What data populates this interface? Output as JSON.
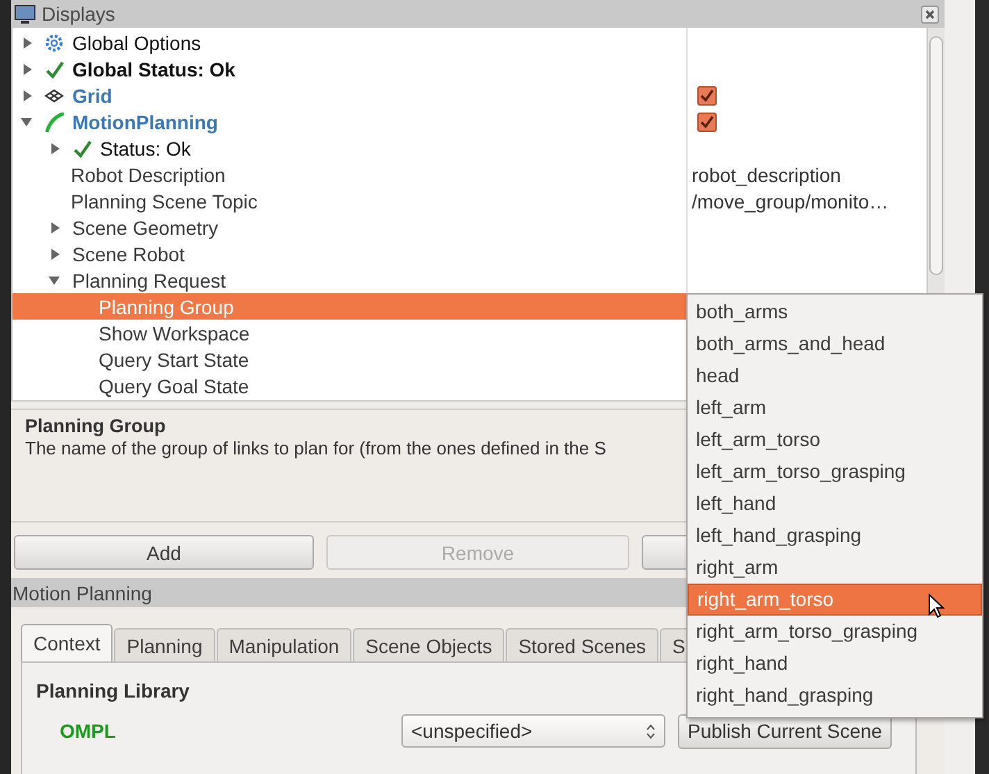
{
  "displays": {
    "title": "Displays",
    "tree": [
      {
        "label": "Global Options",
        "kind": "options",
        "expanded": false,
        "selected": false
      },
      {
        "label": "Global Status: Ok",
        "kind": "status",
        "expanded": false,
        "selected": false
      },
      {
        "label": "Grid",
        "kind": "grid",
        "expanded": false,
        "checked": true,
        "selected": false
      },
      {
        "label": "MotionPlanning",
        "kind": "planner",
        "expanded": true,
        "checked": true,
        "selected": false,
        "children": [
          {
            "label": "Status: Ok",
            "kind": "status",
            "expanded": false,
            "selected": false
          },
          {
            "label": "Robot Description",
            "kind": "property",
            "value": "robot_description",
            "selected": false
          },
          {
            "label": "Planning Scene Topic",
            "kind": "property",
            "value": "/move_group/monito…",
            "selected": false
          },
          {
            "label": "Scene Geometry",
            "kind": "property",
            "expanded": false,
            "selected": false
          },
          {
            "label": "Scene Robot",
            "kind": "property",
            "expanded": false,
            "selected": false
          },
          {
            "label": "Planning Request",
            "kind": "property",
            "expanded": true,
            "selected": false,
            "children": [
              {
                "label": "Planning Group",
                "kind": "property",
                "selected": true
              },
              {
                "label": "Show Workspace",
                "kind": "property",
                "selected": false
              },
              {
                "label": "Query Start State",
                "kind": "property",
                "selected": false
              },
              {
                "label": "Query Goal State",
                "kind": "property",
                "selected": false
              }
            ]
          }
        ]
      }
    ],
    "description": {
      "title": "Planning Group",
      "text": "The name of the group of links to plan for (from the ones defined in the S"
    },
    "buttons": [
      {
        "label": "Add",
        "disabled": false
      },
      {
        "label": "Remove",
        "disabled": true
      },
      {
        "disabled": false
      }
    ]
  },
  "motion_planning": {
    "title": "Motion Planning",
    "tabs": [
      {
        "label": "Context",
        "selected": true
      },
      {
        "label": "Planning",
        "selected": false
      },
      {
        "label": "Manipulation",
        "selected": false
      },
      {
        "label": "Scene Objects",
        "selected": false
      },
      {
        "label": "Stored Scenes",
        "selected": false
      },
      {
        "label": "S",
        "selected": false
      }
    ],
    "context": {
      "section_title": "Planning Library",
      "library": "OMPL",
      "planner_combo": {
        "value": "<unspecified>"
      },
      "publish_button": "Publish Current Scene"
    }
  },
  "group_dropdown": {
    "options": [
      {
        "label": "both_arms",
        "selected": false
      },
      {
        "label": "both_arms_and_head",
        "selected": false
      },
      {
        "label": "head",
        "selected": false
      },
      {
        "label": "left_arm",
        "selected": false
      },
      {
        "label": "left_arm_torso",
        "selected": false
      },
      {
        "label": "left_arm_torso_grasping",
        "selected": false
      },
      {
        "label": "left_hand",
        "selected": false
      },
      {
        "label": "left_hand_grasping",
        "selected": false
      },
      {
        "label": "right_arm",
        "selected": false
      },
      {
        "label": "right_arm_torso",
        "selected": true
      },
      {
        "label": "right_arm_torso_grasping",
        "selected": false
      },
      {
        "label": "right_hand",
        "selected": false
      },
      {
        "label": "right_hand_grasping",
        "selected": false
      }
    ]
  }
}
